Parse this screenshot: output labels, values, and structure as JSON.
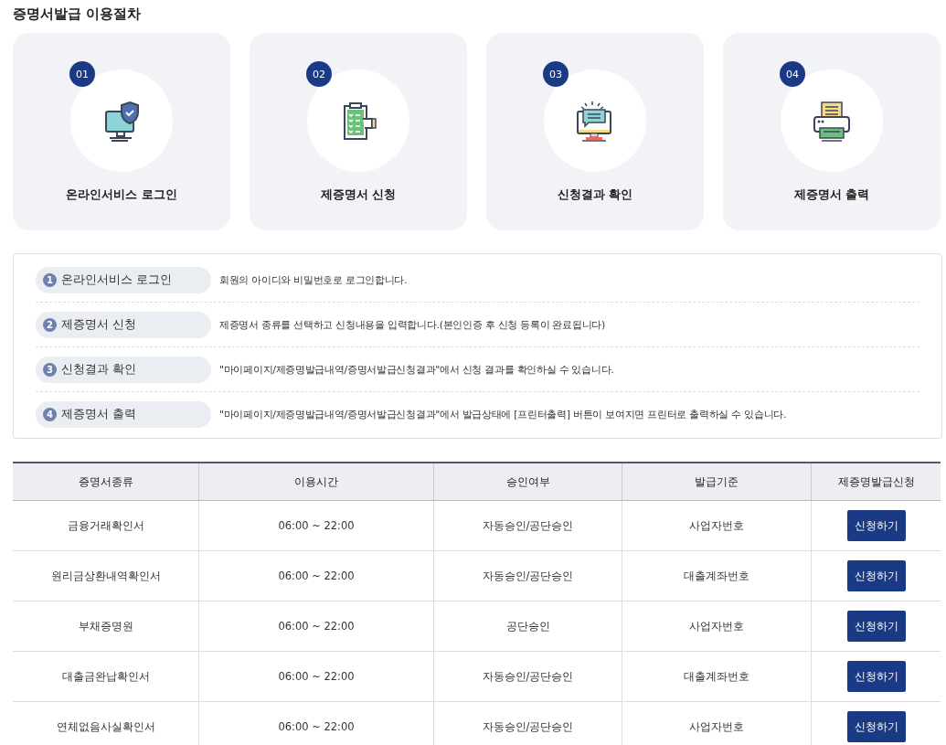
{
  "title": "증명서발급 이용절차",
  "steps": [
    {
      "number": "01",
      "label": "온라인서비스 로그인",
      "kind": "login"
    },
    {
      "number": "02",
      "label": "제증명서 신청",
      "kind": "apply"
    },
    {
      "number": "03",
      "label": "신청결과 확인",
      "kind": "result"
    },
    {
      "number": "04",
      "label": "제증명서 출력",
      "kind": "print"
    }
  ],
  "guide": [
    {
      "number": "1",
      "label": "온라인서비스 로그인",
      "text": "회원의 아이디와 비밀번호로 로그인합니다."
    },
    {
      "number": "2",
      "label": "제증명서 신청",
      "text": "제증명서 종류를 선택하고 신청내용을 입력합니다.(본인인증 후 신청 등록이 완료됩니다)"
    },
    {
      "number": "3",
      "label": "신청결과 확인",
      "text": "\"마이페이지/제증명발급내역/증명서발급신청결과\"에서 신청 결과를 확인하실 수 있습니다."
    },
    {
      "number": "4",
      "label": "제증명서 출력",
      "text": "\"마이페이지/제증명발급내역/증명서발급신청결과\"에서 발급상태에 [프린터출력] 버튼이 보여지면 프린터로 출력하실 수 있습니다."
    }
  ],
  "table": {
    "columns": [
      "증명서종류",
      "이용시간",
      "승인여부",
      "발급기준",
      "제증명발급신청"
    ],
    "rows": [
      {
        "cells": [
          "금융거래확인서",
          "06:00 ~ 22:00",
          "자동승인/공단승인",
          "사업자번호"
        ],
        "button": "신청하기"
      },
      {
        "cells": [
          "원리금상환내역확인서",
          "06:00 ~ 22:00",
          "자동승인/공단승인",
          "대출계좌번호"
        ],
        "button": "신청하기"
      },
      {
        "cells": [
          "부채증명원",
          "06:00 ~ 22:00",
          "공단승인",
          "사업자번호"
        ],
        "button": "신청하기"
      },
      {
        "cells": [
          "대출금완납확인서",
          "06:00 ~ 22:00",
          "자동승인/공단승인",
          "대출계좌번호"
        ],
        "button": "신청하기"
      },
      {
        "cells": [
          "연체없음사실확인서",
          "06:00 ~ 22:00",
          "자동승인/공단승인",
          "사업자번호"
        ],
        "button": "신청하기"
      }
    ]
  }
}
